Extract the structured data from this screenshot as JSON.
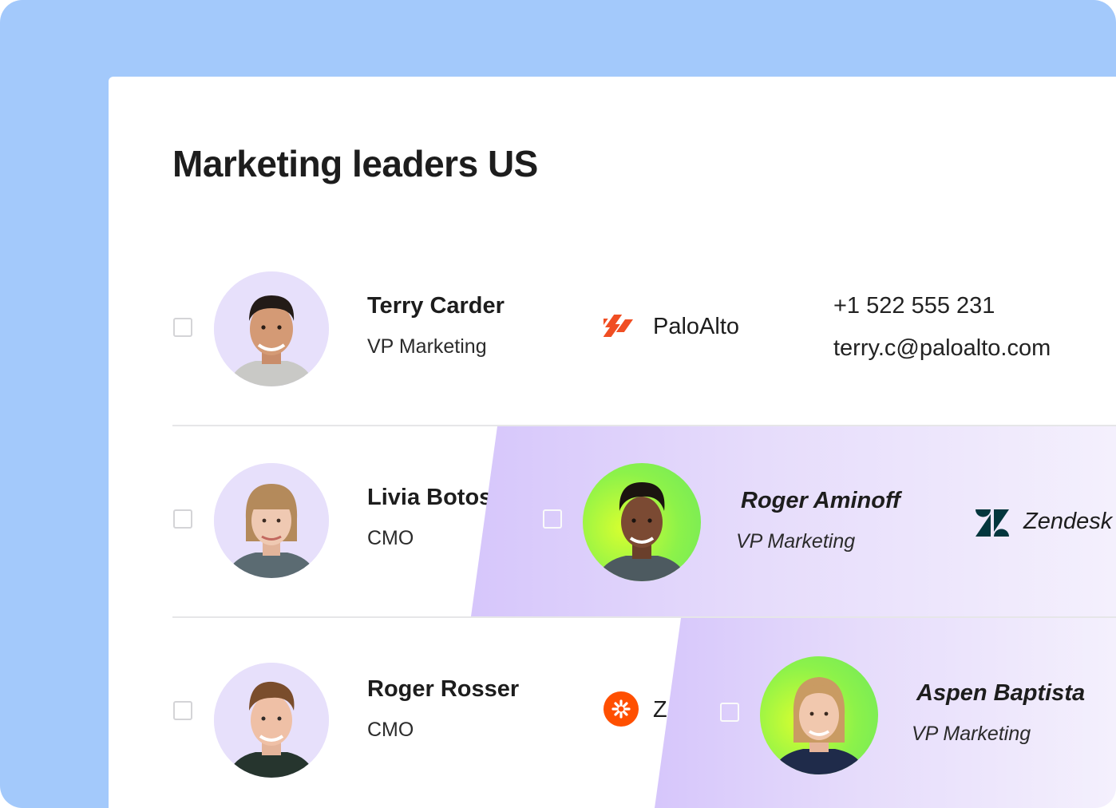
{
  "colors": {
    "background": "#a3c9fb",
    "overlay_gradient_start": "#d6c6fb",
    "overlay_gradient_end": "#f4f0fd",
    "avatar_bg": "#e7e0fb",
    "highlight_ring": "#b4f53a",
    "paloalto_brand": "#f04e23",
    "zendesk_brand": "#03363d",
    "zapier_brand": "#ff4f00"
  },
  "list": {
    "title": "Marketing leaders US",
    "rows": [
      {
        "name": "Terry Carder",
        "role": "VP Marketing",
        "company": "PaloAlto",
        "company_icon": "paloalto-logo-icon",
        "phone": "+1 522 555 231",
        "email": "terry.c@paloalto.com"
      },
      {
        "name": "Livia Botos",
        "role": "CMO"
      },
      {
        "name": "Roger Rosser",
        "role": "CMO",
        "company": "Z",
        "company_icon": "zapier-logo-icon"
      }
    ]
  },
  "overlays": [
    {
      "name": "Roger Aminoff",
      "role": "VP Marketing",
      "company": "Zendesk",
      "company_icon": "zendesk-logo-icon"
    },
    {
      "name": "Aspen Baptista",
      "role": "VP Marketing"
    }
  ]
}
